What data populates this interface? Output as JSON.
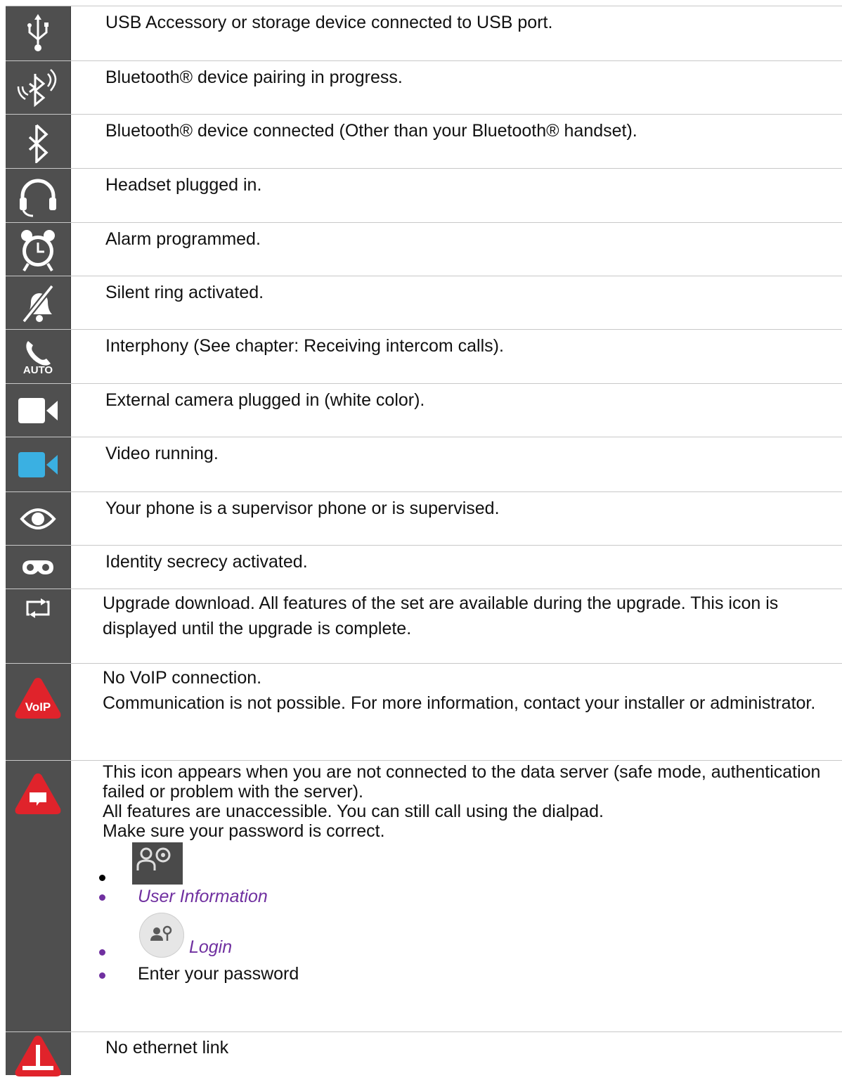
{
  "rows": [
    {
      "icon": "usb-icon",
      "text": "USB Accessory or storage device connected to USB port."
    },
    {
      "icon": "bluetooth-pairing-icon",
      "text": "Bluetooth® device pairing in progress."
    },
    {
      "icon": "bluetooth-icon",
      "text": "Bluetooth® device connected (Other than your Bluetooth® handset)."
    },
    {
      "icon": "headset-icon",
      "text": "Headset plugged in."
    },
    {
      "icon": "alarm-clock-icon",
      "text": "Alarm programmed."
    },
    {
      "icon": "silent-bell-icon",
      "text": "Silent ring activated."
    },
    {
      "icon": "phone-auto-icon",
      "icon_label": "AUTO",
      "text": "Interphony (See chapter: Receiving intercom calls)."
    },
    {
      "icon": "camera-white-icon",
      "icon_color": "#ffffff",
      "text": "External camera plugged in (white color)."
    },
    {
      "icon": "camera-blue-icon",
      "icon_color": "#3ab0e2",
      "text": "Video running."
    },
    {
      "icon": "eye-icon",
      "text": "Your phone is a supervisor phone or is supervised."
    },
    {
      "icon": "mask-icon",
      "text": "Identity secrecy activated."
    },
    {
      "icon": "upgrade-icon",
      "text": "Upgrade download. All features of the set are available during the upgrade. This icon is displayed until the upgrade is complete."
    },
    {
      "icon": "voip-warning-icon",
      "icon_label": "VoIP",
      "line1": "No VoIP connection.",
      "line2": "Communication is not possible. For more information, contact your installer or administrator."
    },
    {
      "icon": "server-warning-icon",
      "para1": "This icon appears when you are not connected to the data server (safe mode, authentication failed or problem with the server).",
      "para2": "All features are unaccessible. You can still call using the dialpad.",
      "para3": "Make sure your password is correct.",
      "steps": [
        {
          "icon": "user-settings-icon",
          "label": ""
        },
        {
          "label": "User Information"
        },
        {
          "icon": "login-icon",
          "label": "Login"
        },
        {
          "label": "Enter your password"
        }
      ]
    },
    {
      "icon": "ethernet-warning-icon",
      "text": "No ethernet link"
    }
  ],
  "colors": {
    "icon_cell": "#4f4f4f",
    "warning_red": "#e0232b",
    "link_purple": "#7030a0",
    "video_blue": "#3ab0e2"
  }
}
